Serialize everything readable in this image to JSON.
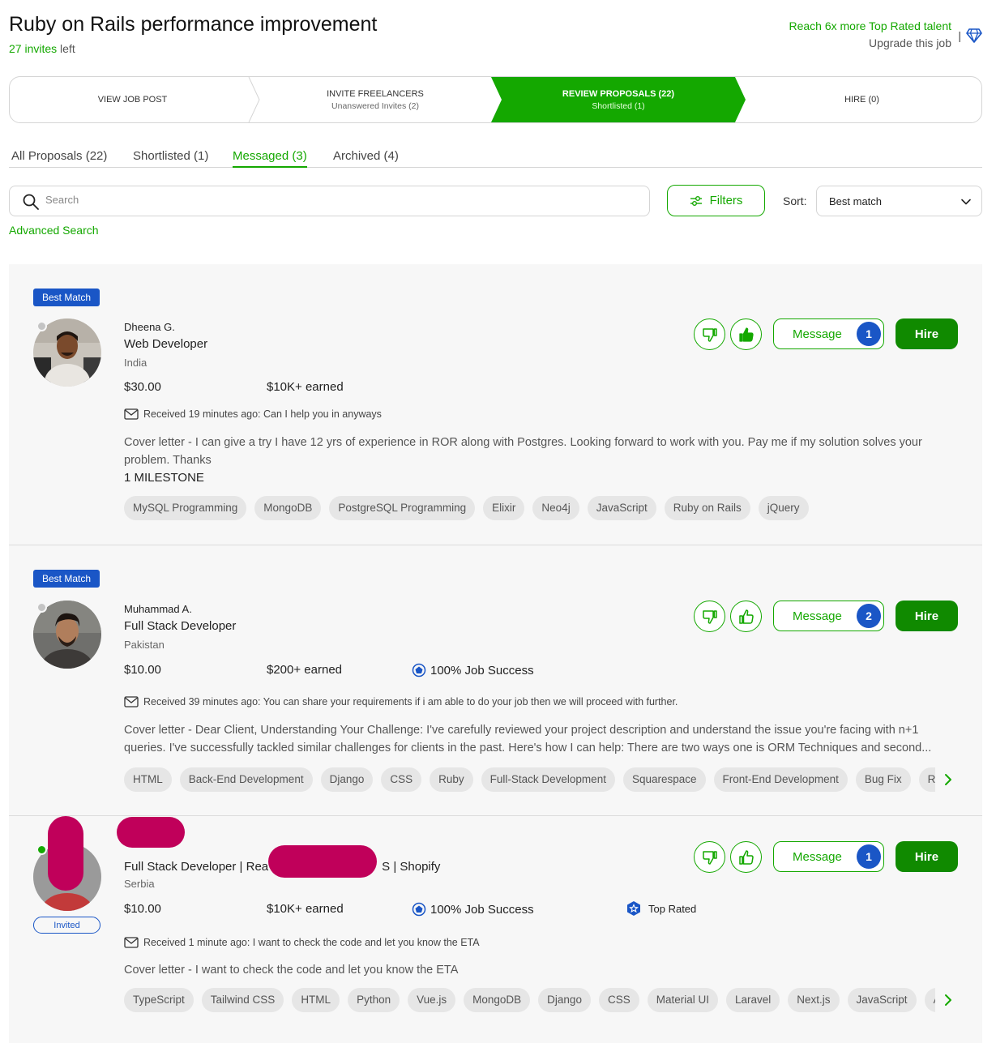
{
  "header": {
    "title": "Ruby on Rails performance improvement",
    "invites_count": "27 invites",
    "invites_suffix": " left",
    "upgrade_line1": "Reach 6x more Top Rated talent",
    "upgrade_line2": "Upgrade this job",
    "upgrade_icon": "diamond-icon"
  },
  "stepper": {
    "steps": [
      {
        "label": "VIEW JOB POST",
        "sub": ""
      },
      {
        "label": "INVITE FREELANCERS",
        "sub": "Unanswered Invites (2)"
      },
      {
        "label": "REVIEW PROPOSALS (22)",
        "sub": "Shortlisted (1)"
      },
      {
        "label": "HIRE (0)",
        "sub": ""
      }
    ],
    "active_index": 2,
    "active_color": "#14a800"
  },
  "tabs": [
    {
      "label": "All Proposals (22)"
    },
    {
      "label": "Shortlisted (1)"
    },
    {
      "label": "Messaged (3)"
    },
    {
      "label": "Archived (4)"
    }
  ],
  "active_tab": 2,
  "search": {
    "placeholder": "Search"
  },
  "filters_label": "Filters",
  "sort": {
    "label": "Sort:",
    "value": "Best match"
  },
  "advanced_search": "Advanced Search",
  "colors": {
    "brand_green": "#14a800",
    "hire_green": "#108a00",
    "badge_blue": "#1a56c6",
    "redaction": "#c0005a"
  },
  "proposals": [
    {
      "badge": "Best Match",
      "name": "Dheena G.",
      "title": "Web Developer",
      "country": "India",
      "rate": "$30.00",
      "earned": "$10K+ earned",
      "received": "Received 19 minutes ago: Can I help you in anyways",
      "cover": "Cover letter - I can give a try I have 12 yrs of experience in ROR along with Postgres. Looking forward to work with you. Pay me if my solution solves your problem. Thanks",
      "milestone": "1 MILESTONE",
      "skills": [
        "MySQL Programming",
        "MongoDB",
        "PostgreSQL Programming",
        "Elixir",
        "Neo4j",
        "JavaScript",
        "Ruby on Rails",
        "jQuery"
      ],
      "message_label": "Message",
      "message_count": "1",
      "hire_label": "Hire",
      "liked": true
    },
    {
      "badge": "Best Match",
      "name": "Muhammad A.",
      "title": "Full Stack Developer",
      "country": "Pakistan",
      "rate": "$10.00",
      "earned": "$200+ earned",
      "job_success": "100% Job Success",
      "received": "Received 39 minutes ago: You can share your requirements if i am able to do your job then we will proceed with further.",
      "cover": "Cover letter - Dear Client, Understanding Your Challenge: I've carefully reviewed your project description and understand the issue you're facing with n+1 queries. I've successfully tackled similar challenges for clients in the past. Here's how I can help: There are two ways one is ORM Techniques and second...",
      "skills": [
        "HTML",
        "Back-End Development",
        "Django",
        "CSS",
        "Ruby",
        "Full-Stack Development",
        "Squarespace",
        "Front-End Development",
        "Bug Fix",
        "REST"
      ],
      "message_label": "Message",
      "message_count": "2",
      "hire_label": "Hire",
      "liked": false
    },
    {
      "badge": "Invited",
      "title_visible_left": "Full Stack Developer | Rea",
      "title_visible_right": "S | Shopify",
      "country": "Serbia",
      "rate": "$10.00",
      "earned": "$10K+ earned",
      "job_success": "100% Job Success",
      "top_rated": "Top Rated",
      "received": "Received 1 minute ago: I want to check the code and let you know the ETA",
      "cover": "Cover letter - I want to check the code and let you know the ETA",
      "skills": [
        "TypeScript",
        "Tailwind CSS",
        "HTML",
        "Python",
        "Vue.js",
        "MongoDB",
        "Django",
        "CSS",
        "Material UI",
        "Laravel",
        "Next.js",
        "JavaScript",
        "Angular"
      ],
      "message_label": "Message",
      "message_count": "1",
      "hire_label": "Hire",
      "liked": false
    }
  ]
}
